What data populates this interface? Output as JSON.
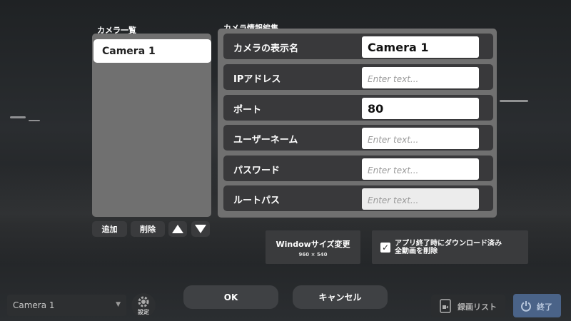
{
  "camera_list": {
    "title": "カメラ一覧",
    "items": [
      {
        "label": "Camera 1"
      }
    ],
    "add_label": "追加",
    "delete_label": "削除"
  },
  "edit_panel": {
    "title": "カメラ情報編集",
    "fields": [
      {
        "label": "カメラの表示名",
        "value": "Camera 1",
        "placeholder": "Enter text..."
      },
      {
        "label": "IPアドレス",
        "value": "",
        "placeholder": "Enter text..."
      },
      {
        "label": "ポート",
        "value": "80",
        "placeholder": "Enter text..."
      },
      {
        "label": "ユーザーネーム",
        "value": "",
        "placeholder": "Enter text..."
      },
      {
        "label": "パスワード",
        "value": "",
        "placeholder": "Enter text..."
      },
      {
        "label": "ルートパス",
        "value": "",
        "placeholder": "Enter text..."
      }
    ]
  },
  "window_size": {
    "label": "Windowサイズ変更",
    "size": "960 × 540"
  },
  "delete_after_download": {
    "checked": true,
    "line1": "アプリ終了時にダウンロード済み",
    "line2": "全動画を削除"
  },
  "footer": {
    "camera_select": "Camera 1",
    "settings_label": "設定",
    "ok_label": "OK",
    "cancel_label": "キャンセル",
    "recordings_label": "録画リスト",
    "quit_label": "終了"
  },
  "colors": {
    "panel": "#707070",
    "field_row": "#39393b",
    "button": "#3a3b3d",
    "quit_accent": "#4a6388"
  },
  "icons": [
    "arrow-up-icon",
    "arrow-down-icon",
    "chevron-down-icon",
    "gear-icon",
    "video-list-icon",
    "power-icon",
    "checkmark-icon"
  ]
}
